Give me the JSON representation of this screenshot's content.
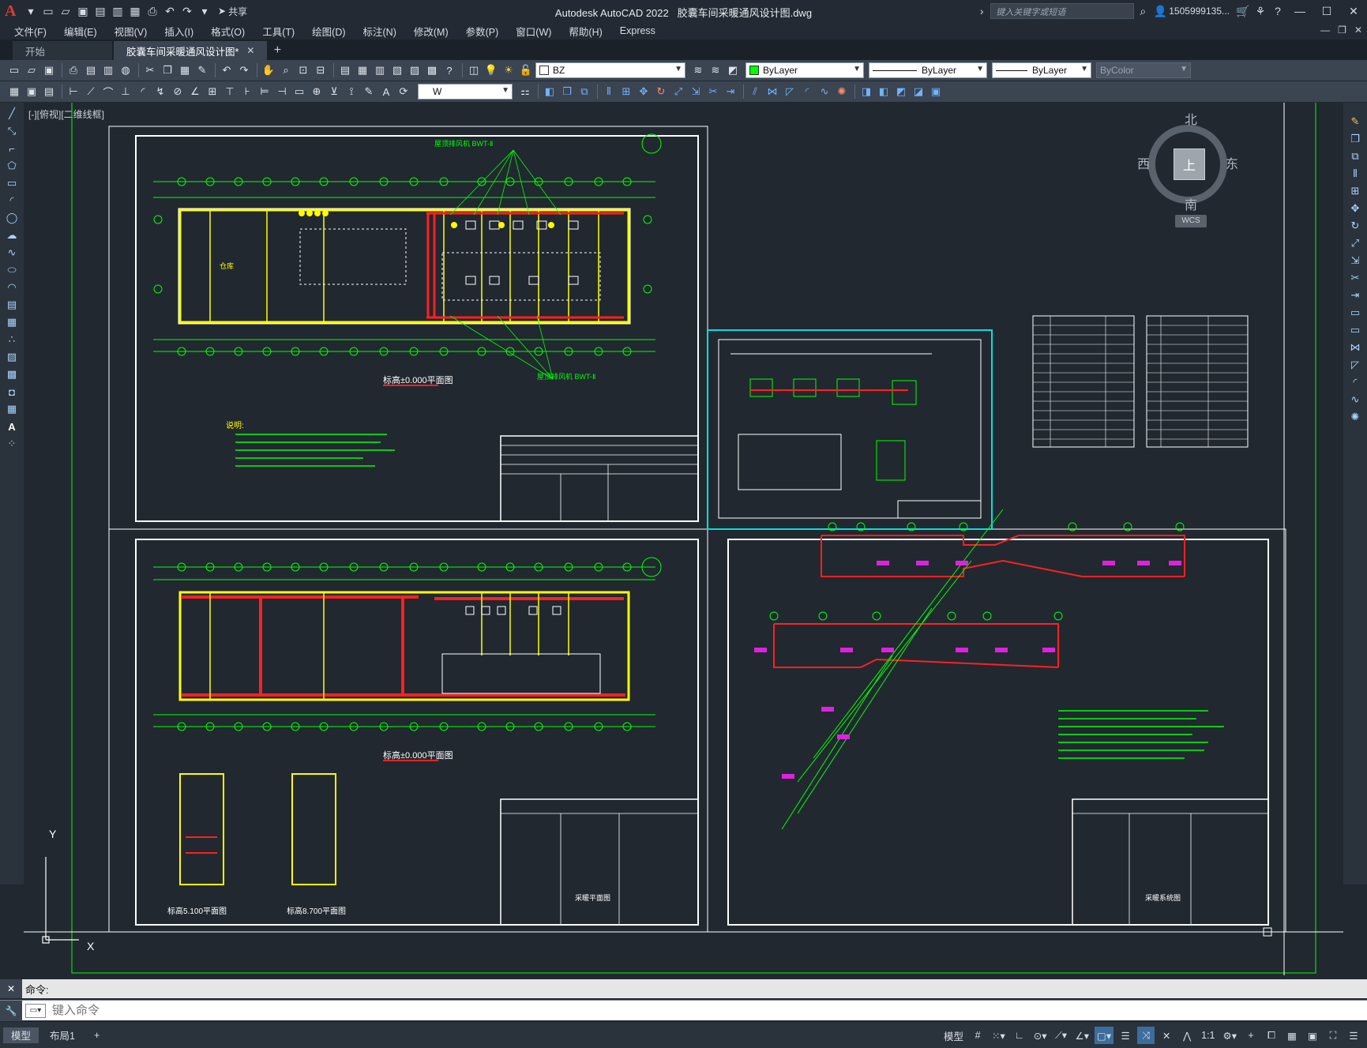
{
  "titlebar": {
    "app_name": "Autodesk AutoCAD 2022",
    "file_name": "胶囊车间采暖通风设计图.dwg",
    "share_label": "共享",
    "search_placeholder": "键入关键字或短语",
    "user": "1505999135..."
  },
  "menu": [
    "文件(F)",
    "编辑(E)",
    "视图(V)",
    "插入(I)",
    "格式(O)",
    "工具(T)",
    "绘图(D)",
    "标注(N)",
    "修改(M)",
    "参数(P)",
    "窗口(W)",
    "帮助(H)",
    "Express"
  ],
  "tabs": {
    "start": "开始",
    "active": "胶囊车间采暖通风设计图*"
  },
  "properties": {
    "layer": "BZ",
    "color": "ByLayer",
    "color_swatch": "#00ff00",
    "linetype": "ByLayer",
    "lineweight": "ByLayer",
    "plotstyle": "ByColor",
    "textstyle_value": "W"
  },
  "viewport": {
    "label": "[-][俯视][二维线框]"
  },
  "viewcube": {
    "north": "北",
    "south": "南",
    "east": "东",
    "west": "西",
    "face": "上",
    "wcs": "WCS"
  },
  "ucs": {
    "x": "X",
    "y": "Y"
  },
  "drawing_text": {
    "plan1_title": "标高±0.000平面图",
    "plan2_title": "标高±0.000平面图",
    "stair1_title": "标高5.100平面图",
    "stair2_title": "标高8.700平面图",
    "notes_label": "说明:",
    "exhaust_fan_label": "屋顶排风机 BWT-Ⅱ",
    "exhaust_fan_label2": "屋顶排风机 BWT-Ⅱ",
    "titleblock_plan": "采暖平面图",
    "titleblock_system": "采暖系统图",
    "warehouse": "仓库"
  },
  "command": {
    "history": "命令:",
    "placeholder": "键入命令"
  },
  "status": {
    "model_tab": "模型",
    "layout_tab": "布局1",
    "model_btn": "模型",
    "scale": "1:1"
  }
}
